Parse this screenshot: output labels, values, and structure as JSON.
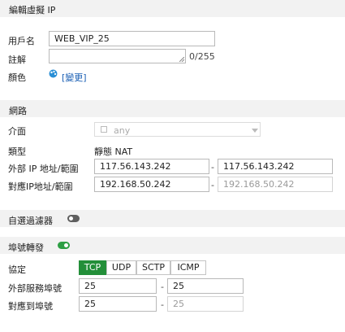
{
  "edit_vip": {
    "title": "編輯虛擬 IP",
    "name_label": "用戶名",
    "name_value": "WEB_VIP_25",
    "comment_label": "註解",
    "comment_value": "",
    "comment_counter": "0/255",
    "color_label": "顏色",
    "color_change_link": "[變更]"
  },
  "network": {
    "title": "網路",
    "interface_label": "介面",
    "interface_value": "any",
    "type_label": "類型",
    "type_value": "靜態 NAT",
    "external_ip_label": "外部 IP 地址/範圍",
    "external_ip_start": "117.56.143.242",
    "external_ip_end": "117.56.143.242",
    "mapped_ip_label": "對應IP地址/範圍",
    "mapped_ip_start": "192.168.50.242",
    "mapped_ip_end": "192.168.50.242",
    "range_separator": "-"
  },
  "optional_filters": {
    "label": "自選過濾器",
    "enabled": false
  },
  "port_forwarding": {
    "label": "埠號轉發",
    "enabled": true,
    "protocol_label": "協定",
    "protocols": [
      "TCP",
      "UDP",
      "SCTP",
      "ICMP"
    ],
    "selected_protocol": "TCP",
    "external_port_label": "外部服務埠號",
    "external_port_start": "25",
    "external_port_end": "25",
    "mapped_port_label": "對應到埠號",
    "mapped_port_start": "25",
    "mapped_port_end": "25"
  },
  "colors": {
    "accent_green": "#238f39",
    "toggle_off": "#5f5f5f",
    "link_blue": "#1a5fb4"
  }
}
